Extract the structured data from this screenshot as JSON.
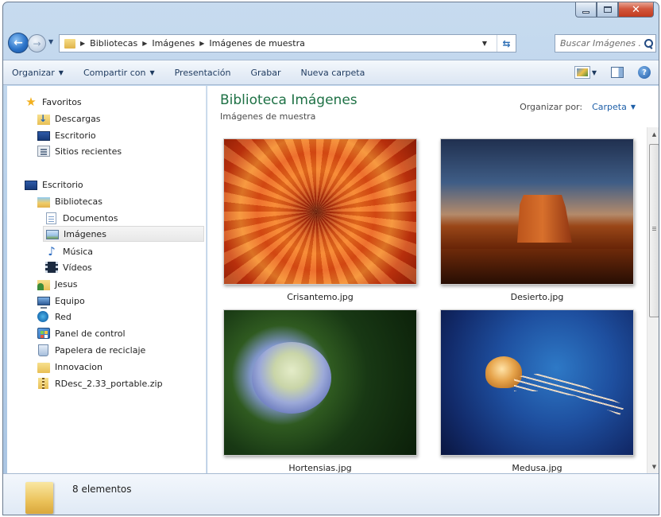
{
  "window": {
    "caption_buttons": {
      "minimize": "minimize-icon",
      "maximize": "maximize-icon",
      "close": "close-icon"
    }
  },
  "address_bar": {
    "breadcrumbs": [
      "Bibliotecas",
      "Imágenes",
      "Imágenes de muestra"
    ],
    "search_placeholder": "Buscar Imágenes ..."
  },
  "toolbar": {
    "organize": "Organizar",
    "share": "Compartir con",
    "slideshow": "Presentación",
    "burn": "Grabar",
    "new_folder": "Nueva carpeta"
  },
  "sidebar": {
    "items": [
      {
        "label": "Favoritos",
        "icon": "star-icon"
      },
      {
        "label": "Descargas",
        "icon": "downloads-folder-icon"
      },
      {
        "label": "Escritorio",
        "icon": "desktop-icon"
      },
      {
        "label": "Sitios recientes",
        "icon": "recent-places-icon"
      },
      {
        "label": "Escritorio",
        "icon": "desktop-icon"
      },
      {
        "label": "Bibliotecas",
        "icon": "libraries-icon"
      },
      {
        "label": "Documentos",
        "icon": "documents-icon"
      },
      {
        "label": "Imágenes",
        "icon": "pictures-icon",
        "selected": true
      },
      {
        "label": "Música",
        "icon": "music-icon"
      },
      {
        "label": "Vídeos",
        "icon": "videos-icon"
      },
      {
        "label": "Jesus",
        "icon": "user-folder-icon"
      },
      {
        "label": "Equipo",
        "icon": "computer-icon"
      },
      {
        "label": "Red",
        "icon": "network-icon"
      },
      {
        "label": "Panel de control",
        "icon": "control-panel-icon"
      },
      {
        "label": "Papelera de reciclaje",
        "icon": "recycle-bin-icon"
      },
      {
        "label": "Innovacion",
        "icon": "folder-icon"
      },
      {
        "label": "RDesc_2.33_portable.zip",
        "icon": "zip-icon"
      }
    ]
  },
  "content": {
    "title": "Biblioteca Imágenes",
    "subtitle": "Imágenes de muestra",
    "arrange_label": "Organizar por:",
    "arrange_value": "Carpeta",
    "files": [
      {
        "name": "Crisantemo.jpg"
      },
      {
        "name": "Desierto.jpg"
      },
      {
        "name": "Hortensias.jpg"
      },
      {
        "name": "Medusa.jpg"
      }
    ]
  },
  "status": {
    "item_count": "8 elementos"
  },
  "colors": {
    "library_title": "#1e7145",
    "link": "#1e5fa8",
    "close_button": "#c23b1f"
  }
}
